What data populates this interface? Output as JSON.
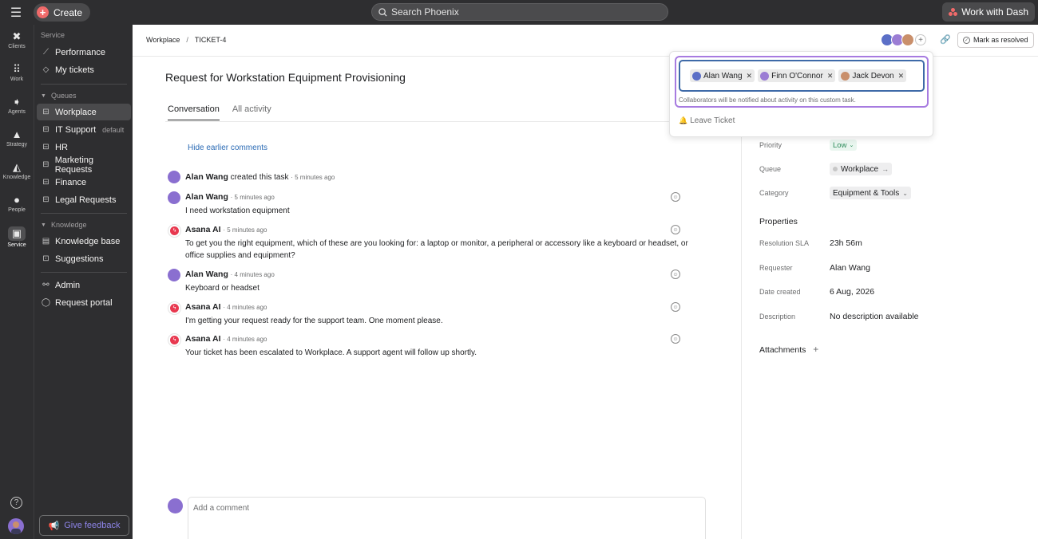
{
  "topbar": {
    "create_label": "Create",
    "search_placeholder": "Search Phoenix",
    "work_with_label": "Work with Dash"
  },
  "rail": {
    "items": [
      {
        "label": "Clients",
        "icon": "clients-icon"
      },
      {
        "label": "Work",
        "icon": "work-icon"
      },
      {
        "label": "Agents",
        "icon": "agents-icon"
      },
      {
        "label": "Strategy",
        "icon": "strategy-icon"
      },
      {
        "label": "Knowledge",
        "icon": "knowledge-icon"
      },
      {
        "label": "People",
        "icon": "people-icon"
      },
      {
        "label": "Service",
        "icon": "service-icon"
      }
    ]
  },
  "sidebar": {
    "service_header": "Service",
    "performance": "Performance",
    "my_tickets": "My tickets",
    "queues_header": "Queues",
    "queues": [
      {
        "label": "Workplace",
        "badge": ""
      },
      {
        "label": "IT Support",
        "badge": "default"
      },
      {
        "label": "HR",
        "badge": ""
      },
      {
        "label": "Marketing Requests",
        "badge": ""
      },
      {
        "label": "Finance",
        "badge": ""
      },
      {
        "label": "Legal Requests",
        "badge": ""
      }
    ],
    "knowledge_header": "Knowledge",
    "knowledge_base": "Knowledge base",
    "suggestions": "Suggestions",
    "admin": "Admin",
    "request_portal": "Request portal",
    "feedback": "Give feedback"
  },
  "header": {
    "breadcrumb_queue": "Workplace",
    "breadcrumb_sep": "/",
    "breadcrumb_ticket": "TICKET-4",
    "resolve_label": "Mark as resolved"
  },
  "ticket": {
    "title": "Request for Workstation Equipment Provisioning",
    "tabs": [
      "Conversation",
      "All activity"
    ],
    "hide_comments": "Hide earlier comments",
    "created": {
      "author": "Alan Wang",
      "action": "created this task",
      "time": "· 5 minutes ago"
    },
    "comments": [
      {
        "author": "Alan Wang",
        "time": "· 5 minutes ago",
        "text": "I need workstation equipment",
        "ai": false
      },
      {
        "author": "Asana AI",
        "time": "· 5 minutes ago",
        "text": "To get you the right equipment, which of these are you looking for: a laptop or monitor, a peripheral or accessory like a keyboard or headset, or office supplies and equipment?",
        "ai": true
      },
      {
        "author": "Alan Wang",
        "time": "· 4 minutes ago",
        "text": "Keyboard or headset",
        "ai": false
      },
      {
        "author": "Asana AI",
        "time": "· 4 minutes ago",
        "text": "I'm getting your request ready for the support team. One moment please.",
        "ai": true
      },
      {
        "author": "Asana AI",
        "time": "· 4 minutes ago",
        "text": "Your ticket has been escalated to Workplace. A support agent will follow up shortly.",
        "ai": true
      }
    ],
    "comment_placeholder": "Add a comment"
  },
  "details": {
    "priority_label": "Priority",
    "priority_value": "Low",
    "queue_label": "Queue",
    "queue_value": "Workplace",
    "category_label": "Category",
    "category_value": "Equipment & Tools",
    "properties_title": "Properties",
    "sla_label": "Resolution SLA",
    "sla_value": "23h 56m",
    "requester_label": "Requester",
    "requester_value": "Alan Wang",
    "date_label": "Date created",
    "date_value": "6 Aug, 2026",
    "description_label": "Description",
    "description_value": "No description available",
    "attachments_title": "Attachments"
  },
  "collaborators": {
    "people": [
      "Alan Wang",
      "Finn O'Connor",
      "Jack Devon"
    ],
    "note": "Collaborators will be notified about activity on this custom task.",
    "leave_label": "Leave Ticket"
  },
  "colors": {
    "accent_red": "#f06a6a",
    "focus_purple": "#a77be0",
    "focus_blue": "#3e6aa8",
    "link_blue": "#2b6bb5",
    "low_green": "#2a8a59"
  }
}
